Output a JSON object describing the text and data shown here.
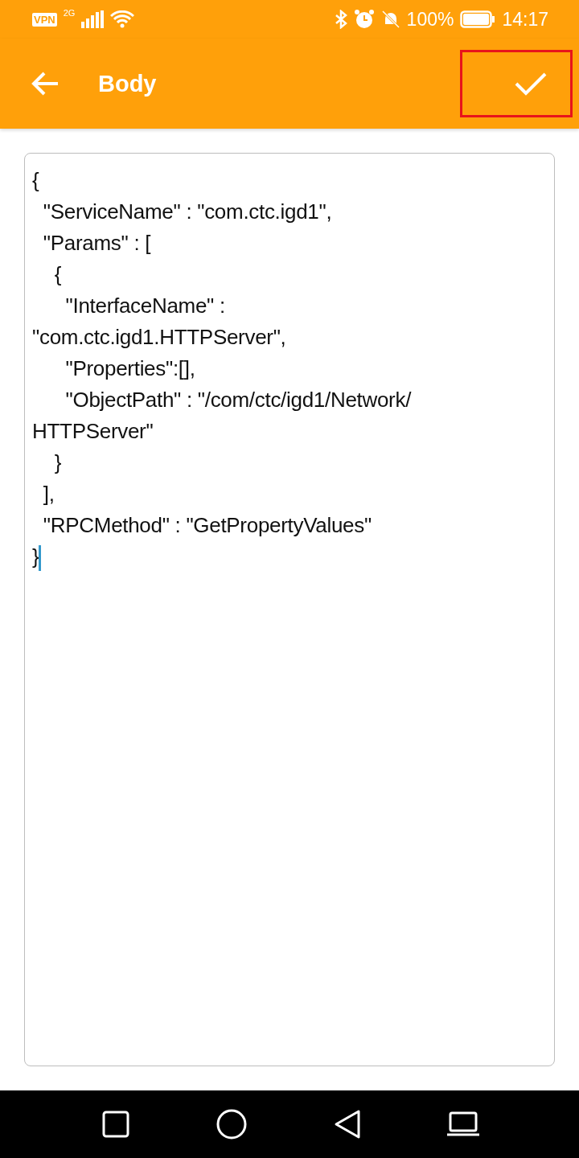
{
  "status_bar": {
    "vpn": "VPN",
    "network": "2G",
    "battery": "100%",
    "time": "14:17"
  },
  "app_bar": {
    "title": "Body",
    "confirm_highlighted": true
  },
  "editor": {
    "lines": [
      "{",
      "  \"ServiceName\" : \"com.ctc.igd1\",",
      "  \"Params\" : [",
      "    {",
      "      \"InterfaceName\" :",
      "\"com.ctc.igd1.HTTPServer\",",
      "      \"Properties\":[],",
      "      \"ObjectPath\" : \"/com/ctc/igd1/Network/",
      "HTTPServer\"",
      "    }",
      "  ],",
      "  \"RPCMethod\" : \"GetPropertyValues\"",
      "}"
    ],
    "cursor_visible": true
  }
}
